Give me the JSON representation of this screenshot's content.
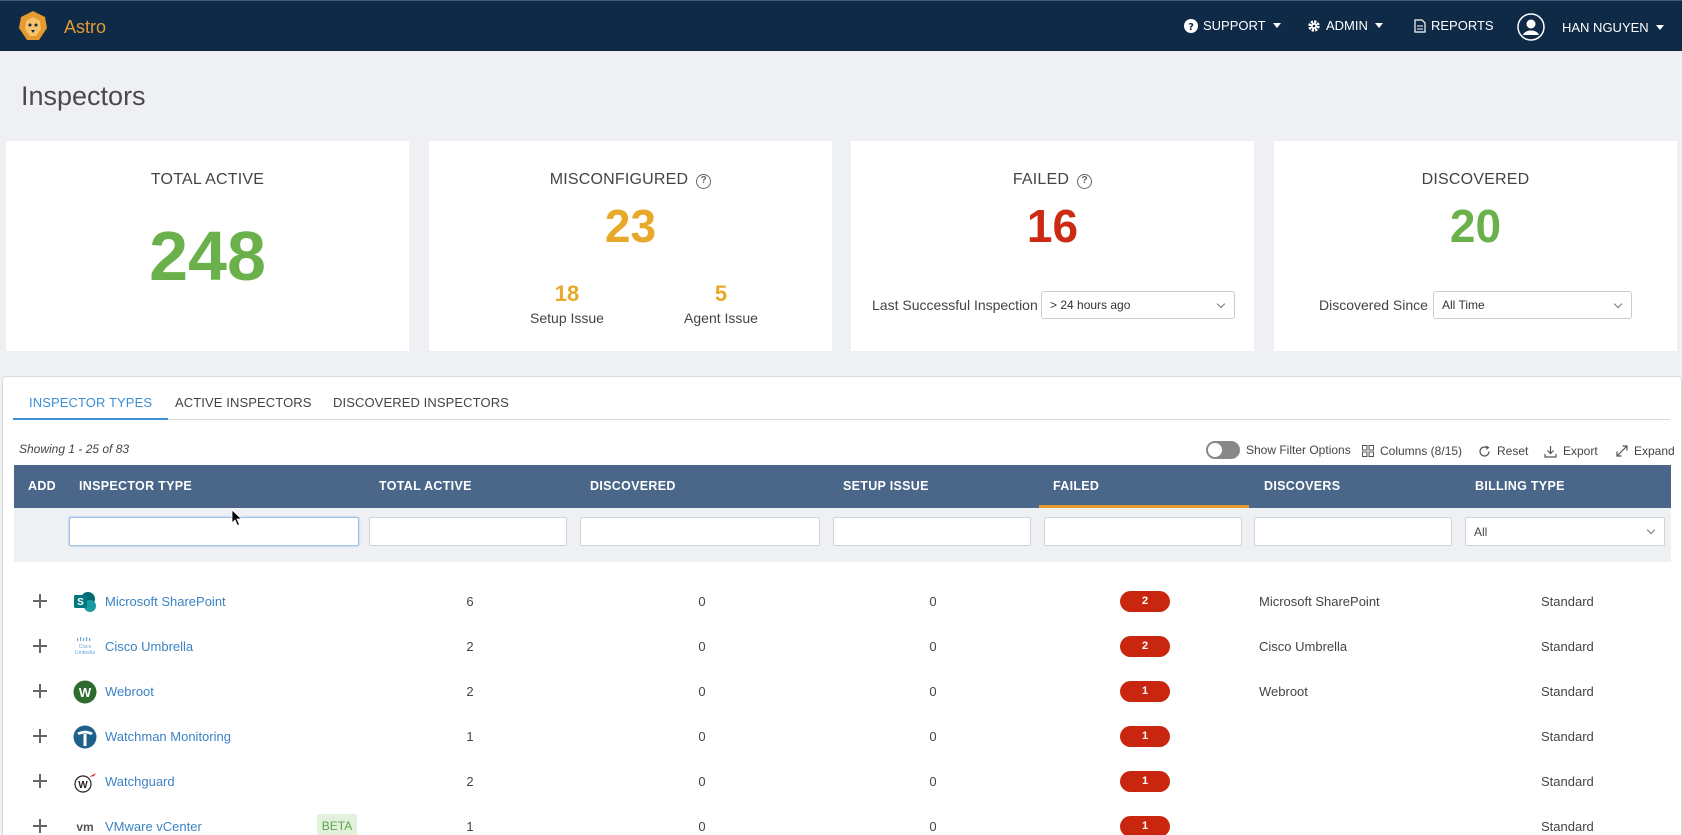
{
  "header": {
    "app_name": "Astro",
    "nav": {
      "support": "SUPPORT",
      "admin": "ADMIN",
      "reports": "REPORTS",
      "user": "HAN NGUYEN"
    }
  },
  "page": {
    "title": "Inspectors"
  },
  "cards": {
    "total_active": {
      "title": "TOTAL ACTIVE",
      "value": "248",
      "color": "#6bb14b"
    },
    "misconfigured": {
      "title": "MISCONFIGURED",
      "value": "23",
      "color": "#e8a82a",
      "setup_issue_value": "18",
      "setup_issue_label": "Setup Issue",
      "agent_issue_value": "5",
      "agent_issue_label": "Agent Issue"
    },
    "failed": {
      "title": "FAILED",
      "value": "16",
      "color": "#cc2a12",
      "filter_label": "Last Successful Inspection",
      "filter_value": "> 24 hours ago"
    },
    "discovered": {
      "title": "DISCOVERED",
      "value": "20",
      "color": "#6bb14b",
      "filter_label": "Discovered Since",
      "filter_value": "All Time"
    }
  },
  "tabs": [
    {
      "label": "INSPECTOR TYPES",
      "active": true
    },
    {
      "label": "ACTIVE INSPECTORS",
      "active": false
    },
    {
      "label": "DISCOVERED INSPECTORS",
      "active": false
    }
  ],
  "toolbar": {
    "showing": "Showing 1 - 25 of 83",
    "show_filter_options": "Show Filter Options",
    "columns": "Columns (8/15)",
    "reset": "Reset",
    "export": "Export",
    "expand": "Expand"
  },
  "table": {
    "columns": [
      "ADD",
      "INSPECTOR TYPE",
      "TOTAL ACTIVE",
      "DISCOVERED",
      "SETUP ISSUE",
      "FAILED",
      "DISCOVERS",
      "BILLING TYPE"
    ],
    "billing_filter": "All",
    "rows": [
      {
        "name": "Microsoft SharePoint",
        "icon": "sharepoint-icon",
        "total_active": "6",
        "discovered": "0",
        "setup_issue": "0",
        "failed": "2",
        "discovers": "Microsoft SharePoint",
        "billing": "Standard"
      },
      {
        "name": "Cisco Umbrella",
        "icon": "cisco-umbrella-icon",
        "total_active": "2",
        "discovered": "0",
        "setup_issue": "0",
        "failed": "2",
        "discovers": "Cisco Umbrella",
        "billing": "Standard"
      },
      {
        "name": "Webroot",
        "icon": "webroot-icon",
        "total_active": "2",
        "discovered": "0",
        "setup_issue": "0",
        "failed": "1",
        "discovers": "Webroot",
        "billing": "Standard"
      },
      {
        "name": "Watchman Monitoring",
        "icon": "watchman-icon",
        "total_active": "1",
        "discovered": "0",
        "setup_issue": "0",
        "failed": "1",
        "discovers": "",
        "billing": "Standard"
      },
      {
        "name": "Watchguard",
        "icon": "watchguard-icon",
        "total_active": "2",
        "discovered": "0",
        "setup_issue": "0",
        "failed": "1",
        "discovers": "",
        "billing": "Standard"
      },
      {
        "name": "VMware vCenter",
        "icon": "vmware-icon",
        "beta": "BETA",
        "total_active": "1",
        "discovered": "0",
        "setup_issue": "0",
        "failed": "1",
        "discovers": "",
        "billing": "Standard"
      }
    ]
  }
}
